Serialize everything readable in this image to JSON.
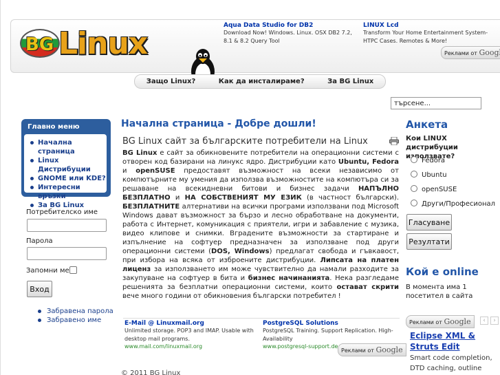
{
  "header": {
    "logo_text": "Linux",
    "logo_badge": "BG",
    "ads": [
      {
        "title": "Aqua Data Studio for DB2",
        "text": "Download Now! Windows. Linux. OSX DB2 7.2, 8.1 & 8.2 Query Tool"
      },
      {
        "title": "LINUX Lcd",
        "text": "Transform Your Home Entertainment System- HTPC Cases. Remotes & More!"
      }
    ],
    "google_label": "Реклами от",
    "google_word": "Google"
  },
  "nav": {
    "items": [
      "Защо Linux?",
      "Как да инсталираме?",
      "За BG Linux"
    ]
  },
  "search": {
    "value": "търсене..."
  },
  "sidebar": {
    "menu_title": "Главно меню",
    "menu_items": [
      "Начална страница",
      "Linux Дистрибуции",
      "GNOME или KDE?",
      "Интересни връзки",
      "За BG Linux"
    ],
    "username_label": "Потребителско име",
    "password_label": "Парола",
    "remember_label": "Запомни ме",
    "login_button": "Вход",
    "links": [
      "Забравена парола",
      "Забравено име"
    ]
  },
  "main": {
    "title": "Начална страница - Добре дошли!",
    "article_title": "BG Linux сайт за българските потребители на Linux",
    "article": [
      {
        "b": "BG Linux"
      },
      {
        "t": " е сайт за обикновените потребители на операционни системи с отворен код базирани на линукс ядро.  Дистрибуции като "
      },
      {
        "b": "Ubuntu, Fedora"
      },
      {
        "t": " и "
      },
      {
        "b": "openSUSE"
      },
      {
        "t": " предоставят възможност на всеки независимо от компютърните му умения да използва възможностите на компютъра си за решаване на всекидневни битови и бизнес задачи "
      },
      {
        "b": "НАПЪЛНО БЕЗПЛАТНО"
      },
      {
        "t": " и "
      },
      {
        "b": "НА СОБСТВЕНИЯТ МУ ЕЗИК"
      },
      {
        "t": " (в частност български). "
      },
      {
        "b": "БЕЗПЛАТНИТЕ"
      },
      {
        "t": " алтернативи на всички програми използвани под Microsoft Windows дават възможност за бързо и лесно обработване на документи, работа с Интернет, комуникация с приятели, игри и забавление с музика, видео клипове и снимки. Вградените възможности за стартиране и изпълнение на софтуер предназначен за използване под други операционни системи ("
      },
      {
        "b": "DOS, Windows"
      },
      {
        "t": ") предлагат свобода и гъвкавост, при избора на всяка от изброените дистрибуции. "
      },
      {
        "b": "Липсата на платен лиценз"
      },
      {
        "t": " за използването им може чувствително да намали разходите за закупуване на софтуер в бита и "
      },
      {
        "b": "бизнес начинанията"
      },
      {
        "t": ". Нека разгледаме решенията за безплатни операционни системи, които "
      },
      {
        "b": "остават скрити"
      },
      {
        "t": " вече много години от обикновения български потребител !"
      }
    ],
    "ads": [
      {
        "title": "E-Mail @ Linuxmail.org",
        "text": "Unlimited storage. POP3 and IMAP. Usable with desktop mail programs.",
        "url": "www.mail.com/linuxmail.org"
      },
      {
        "title": "PostgreSQL Solutions",
        "text": "PostgreSQL Training. Support Replication. High-Availability",
        "url": "www.postgresql-support.de"
      }
    ],
    "copyright": "© 2011 BG Linux"
  },
  "poll": {
    "title": "Анкета",
    "question": "Кои LINUX дистрибуции използвате?",
    "options": [
      "Fedora",
      "Ubuntu",
      "openSUSE",
      "Други/Професионал"
    ],
    "vote_button": "Гласуване",
    "results_button": "Резултати"
  },
  "online": {
    "title": "Кой е online",
    "text": "В момента има 1 посетител в сайта"
  },
  "right_ad": {
    "title": "Eclipse XML & Struts Edit",
    "text": "Smart code completion, DTD caching, outline"
  },
  "colors": {
    "accent": "#2256a8",
    "menu_bg": "#2d5e9e",
    "logo": "#e8a21a"
  }
}
